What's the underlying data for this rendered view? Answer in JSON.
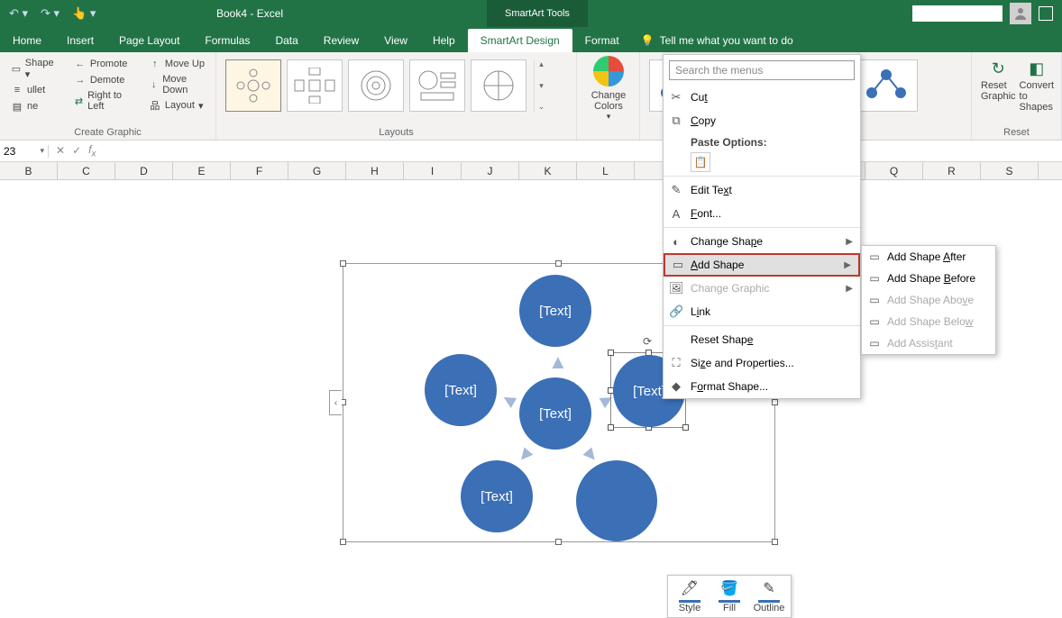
{
  "titlebar": {
    "app_title": "Book4 - Excel",
    "tools_title": "SmartArt Tools"
  },
  "tabs": {
    "items": [
      "Home",
      "Insert",
      "Page Layout",
      "Formulas",
      "Data",
      "Review",
      "View",
      "Help",
      "SmartArt Design",
      "Format"
    ],
    "active_index": 8,
    "tellme": "Tell me what you want to do"
  },
  "ribbon": {
    "create_graphic": {
      "label": "Create Graphic",
      "add_shape": "Add Shape",
      "add_bullet": "Add Bullet",
      "text_pane": "Text Pane",
      "promote": "Promote",
      "demote": "Demote",
      "right_to_left": "Right to Left",
      "move_up": "Move Up",
      "move_down": "Move Down",
      "layout": "Layout"
    },
    "layouts": {
      "label": "Layouts"
    },
    "change_colors": "Change Colors",
    "reset": {
      "label": "Reset",
      "reset_graphic": "Reset Graphic",
      "convert": "Convert to Shapes"
    }
  },
  "fxbar": {
    "namebox": "23"
  },
  "columns": [
    "B",
    "C",
    "D",
    "E",
    "F",
    "G",
    "H",
    "I",
    "J",
    "K",
    "L",
    "",
    "",
    "",
    "",
    "Q",
    "R",
    "S"
  ],
  "smartart": {
    "center": "[Text]",
    "nodes": [
      "[Text]",
      "[Text]",
      "[Text]",
      "[Text]",
      ""
    ]
  },
  "minitool": {
    "style": "Style",
    "fill": "Fill",
    "outline": "Outline"
  },
  "ctx": {
    "search_placeholder": "Search the menus",
    "cut": "Cut",
    "copy": "Copy",
    "paste_options": "Paste Options:",
    "edit_text": "Edit Text",
    "font": "Font...",
    "change_shape": "Change Shape",
    "add_shape": "Add Shape",
    "change_graphic": "Change Graphic",
    "link": "Link",
    "reset_shape": "Reset Shape",
    "size_props": "Size and Properties...",
    "format_shape": "Format Shape..."
  },
  "submenu": {
    "after": "Add Shape After",
    "before": "Add Shape Before",
    "above": "Add Shape Above",
    "below": "Add Shape Below",
    "assistant": "Add Assistant"
  }
}
